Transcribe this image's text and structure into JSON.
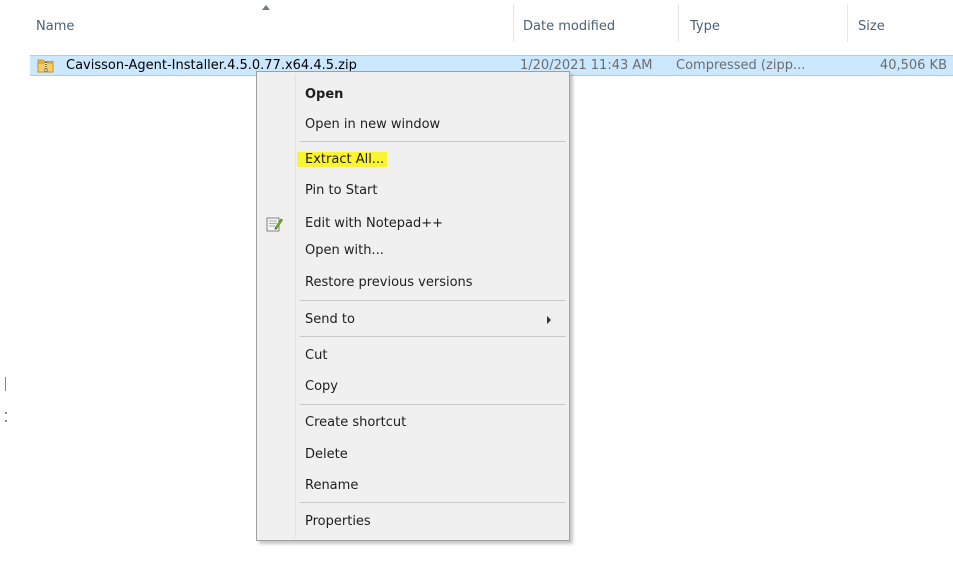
{
  "columns": {
    "name": "Name",
    "date_modified": "Date modified",
    "type": "Type",
    "size": "Size"
  },
  "file": {
    "name": "Cavisson-Agent-Installer.4.5.0.77.x64.4.5.zip",
    "date_modified": "1/20/2021 11:43 AM",
    "type": "Compressed (zipp...",
    "size": "40,506 KB",
    "icon": "zip-folder-icon"
  },
  "context_menu": {
    "open": "Open",
    "open_new_window": "Open in new window",
    "extract_all": "Extract All...",
    "pin_to_start": "Pin to Start",
    "edit_notepad": "Edit with Notepad++",
    "open_with": "Open with...",
    "restore_previous": "Restore previous versions",
    "send_to": "Send to",
    "cut": "Cut",
    "copy": "Copy",
    "create_shortcut": "Create shortcut",
    "delete": "Delete",
    "rename": "Rename",
    "properties": "Properties"
  },
  "colors": {
    "selection": "#cce8ff",
    "highlight": "#fbf531",
    "header_text": "#4c607a"
  }
}
